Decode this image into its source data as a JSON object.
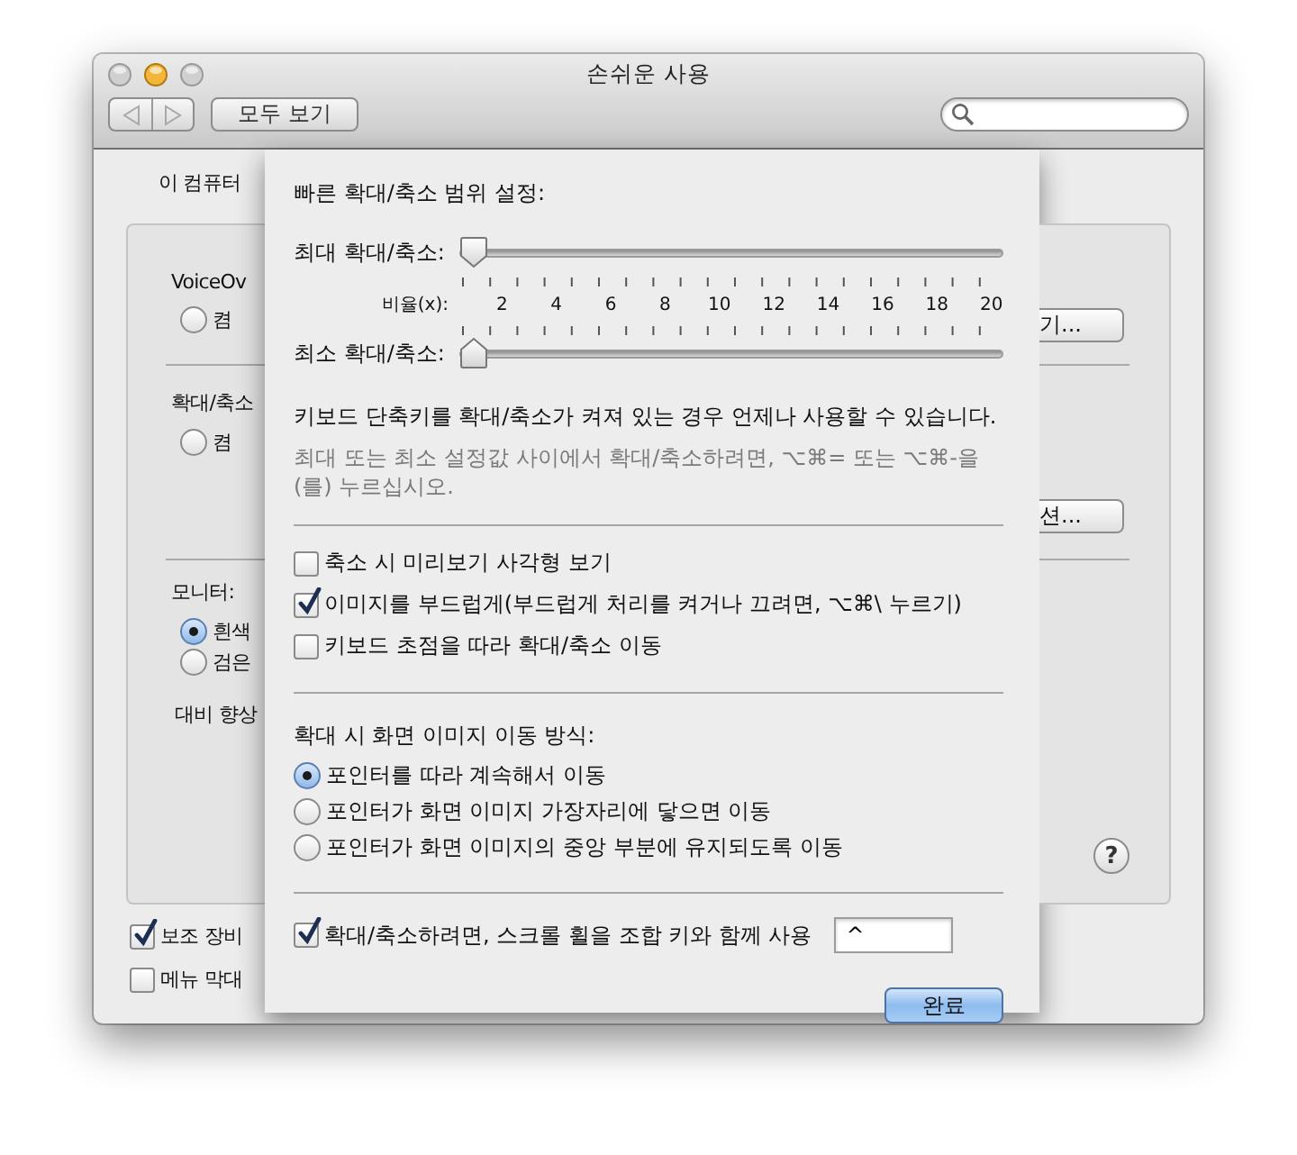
{
  "window": {
    "title": "손쉬운 사용"
  },
  "toolbar": {
    "nav_buttons": [
      {
        "kind": "back",
        "disabled": true
      },
      {
        "kind": "forward",
        "disabled": true
      }
    ],
    "show_all_button": "모두 보기"
  },
  "background": {
    "heading": "이 컴퓨터",
    "sections": [
      {
        "label": "VoiceOv",
        "radios": [
          {
            "label": "켬",
            "selected": false
          }
        ],
        "button": "기..."
      },
      {
        "label": "확대/축소",
        "radios": [
          {
            "label": "켬",
            "selected": false
          }
        ],
        "button": "션..."
      },
      {
        "label": "모니터:",
        "radios": [
          {
            "label": "흰색",
            "selected": true
          },
          {
            "label": "검은",
            "selected": false
          }
        ],
        "note": "대비 향상"
      }
    ],
    "help": "?",
    "checkboxes": [
      {
        "label": "보조 장비",
        "checked": true
      },
      {
        "label": "메뉴 막대",
        "checked": false
      }
    ]
  },
  "sheet": {
    "title": "빠른 확대/축소 범위 설정:",
    "sliders": [
      {
        "label": "최대 확대/축소:",
        "level": 0,
        "kind": "down"
      },
      {
        "label": "최소 확대/축소:",
        "level": 0,
        "kind": "up"
      }
    ],
    "scale": {
      "label": "비율(x):",
      "ticks": [
        "2",
        "4",
        "6",
        "8",
        "10",
        "12",
        "14",
        "16",
        "18",
        "20"
      ]
    },
    "shortcut_note": "키보드 단축키를 확대/축소가 켜져 있는 경우 언제나 사용할 수 있습니다.",
    "shortcut_hint": "최대 또는 최소 설정값 사이에서 확대/축소하려면, ⌥⌘= 또는 ⌥⌘-을(를) 누르십시오.",
    "checkboxes": [
      {
        "label": "축소 시 미리보기 사각형 보기",
        "checked": false
      },
      {
        "label": "이미지를 부드럽게(부드럽게 처리를 켜거나 끄려면, ⌥⌘\\ 누르기)",
        "checked": true
      },
      {
        "label": "키보드 초점을 따라 확대/축소 이동",
        "checked": false
      }
    ],
    "movement": {
      "title": "확대 시 화면 이미지 이동 방식:",
      "options": [
        {
          "label": "포인터를 따라 계속해서 이동",
          "selected": true
        },
        {
          "label": "포인터가 화면 이미지 가장자리에 닿으면 이동",
          "selected": false
        },
        {
          "label": "포인터가 화면 이미지의 중앙 부분에 유지되도록 이동",
          "selected": false
        }
      ]
    },
    "scroll_zoom": {
      "label": "확대/축소하려면, 스크롤 휠을 조합 키와 함께 사용",
      "checked": true,
      "modifier": "^"
    },
    "done_button": "완료"
  }
}
